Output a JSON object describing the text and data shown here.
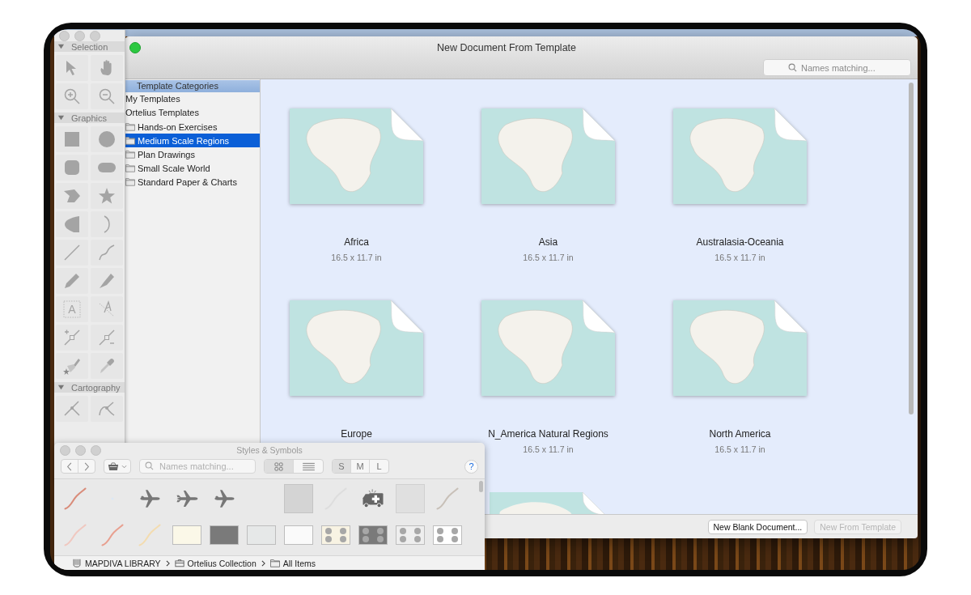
{
  "main_window": {
    "title": "New Document From Template",
    "search": {
      "placeholder": "Names matching..."
    },
    "sidebar": {
      "header": "Template Categories",
      "items": [
        {
          "label": "My Templates",
          "selected": false
        },
        {
          "label": "Ortelius Templates",
          "selected": false,
          "children": [
            {
              "label": "Hands-on Exercises",
              "selected": false
            },
            {
              "label": "Medium Scale Regions",
              "selected": true
            },
            {
              "label": "Plan Drawings",
              "selected": false
            },
            {
              "label": "Small Scale World",
              "selected": false
            },
            {
              "label": "Standard Paper & Charts",
              "selected": false
            }
          ]
        }
      ]
    },
    "templates": [
      {
        "kind": "card",
        "name": "Africa",
        "size": "16.5 x 11.7 in"
      },
      {
        "kind": "card",
        "name": "Asia",
        "size": "16.5 x 11.7 in"
      },
      {
        "kind": "card",
        "name": "Australasia-Oceania",
        "size": "16.5 x 11.7 in"
      },
      {
        "kind": "card",
        "name": "Europe"
      },
      {
        "kind": "card",
        "name": "N_America Natural Regions",
        "size": "16.5 x 11.7 in"
      },
      {
        "kind": "card",
        "name": "North America",
        "size": "16.5 x 11.7 in"
      },
      {
        "kind": "peek"
      }
    ],
    "buttons": [
      {
        "label": "New Blank Document...",
        "disabled": false
      },
      {
        "label": "New From Template",
        "disabled": true
      }
    ]
  },
  "tool_palette": {
    "sections": [
      {
        "title": "Selection",
        "expanded": true
      },
      {
        "title": "Graphics",
        "expanded": true,
        "tool_letter": "A"
      },
      {
        "title": "Cartography",
        "expanded": true
      }
    ]
  },
  "styles_window": {
    "title": "Styles & Symbols",
    "search": {
      "placeholder": "Names matching..."
    },
    "views": [
      {
        "kind": "grid",
        "selected": true
      },
      {
        "kind": "list",
        "selected": false
      }
    ],
    "sizes": [
      {
        "label": "S",
        "selected": true
      },
      {
        "label": "M",
        "selected": false
      },
      {
        "label": "L",
        "selected": false
      }
    ],
    "help": "?",
    "symbols": [
      {
        "kind": "line",
        "color": "#d98c7a"
      },
      {
        "kind": "dot",
        "color": "#dce8f4"
      },
      {
        "kind": "plane"
      },
      {
        "kind": "jet"
      },
      {
        "kind": "plane"
      },
      {
        "kind": "blank"
      },
      {
        "kind": "fill",
        "color": "#d4d4d4"
      },
      {
        "kind": "line",
        "color": "#dddddd"
      },
      {
        "kind": "ambulance"
      },
      {
        "kind": "texture",
        "color": "#e0e0e0"
      },
      {
        "kind": "line",
        "color": "#c8c0b8"
      },
      {
        "kind": "line",
        "color": "#f0c8c0"
      },
      {
        "kind": "line",
        "color": "#e8a090"
      },
      {
        "kind": "line",
        "color": "#f3dcb0"
      },
      {
        "kind": "fill",
        "color": "#fbf8e8"
      },
      {
        "kind": "fill",
        "color": "#7a7a7a"
      },
      {
        "kind": "fill",
        "color": "#e6e8e8"
      },
      {
        "kind": "fill",
        "color": "#fafafa"
      },
      {
        "kind": "dots",
        "color": "#f8f3e3"
      },
      {
        "kind": "dots",
        "color": "#7a7a7a"
      },
      {
        "kind": "dots",
        "color": "#eeeeee"
      },
      {
        "kind": "dots",
        "color": "#ffffff"
      }
    ],
    "breadcrumb": [
      {
        "kind": "library",
        "label": "MAPDIVA LIBRARY"
      },
      {
        "kind": "collection",
        "label": "Ortelius Collection"
      },
      {
        "kind": "folder",
        "label": "All Items"
      }
    ]
  }
}
